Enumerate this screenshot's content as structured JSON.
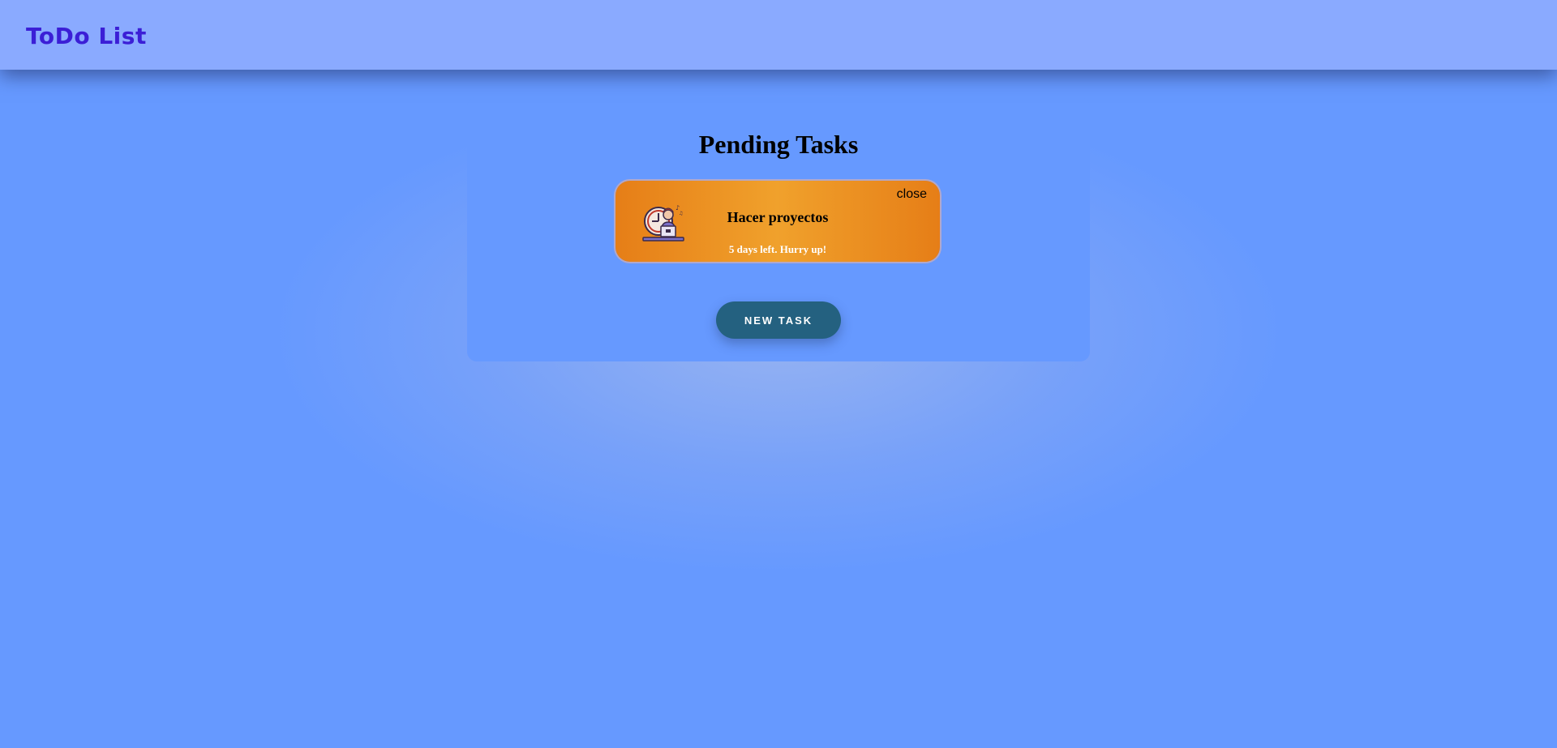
{
  "header": {
    "brand": "ToDo List"
  },
  "main": {
    "title": "Pending Tasks",
    "tasks": [
      {
        "close_label": "close",
        "name": "Hacer proyectos",
        "due_text": "5 days left. Hurry up!",
        "icon": "person-at-computer-icon"
      }
    ],
    "new_task_label": "New Task"
  },
  "colors": {
    "background": "#6699ff",
    "navbar": "#8aaaff",
    "brand": "#3b1fd6",
    "card_orange": "#e67e17",
    "button": "#246180"
  }
}
